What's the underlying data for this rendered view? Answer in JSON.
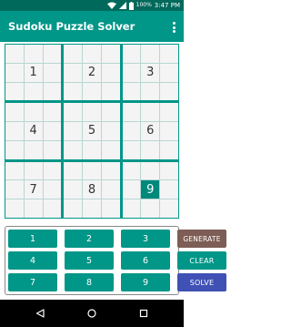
{
  "status_bar": {
    "battery": "100%",
    "time": "3:47 PM"
  },
  "app_bar": {
    "title": "Sudoku Puzzle Solver"
  },
  "board": {
    "boxes": [
      [
        "",
        "",
        "",
        "",
        "1",
        "",
        "",
        "",
        ""
      ],
      [
        "",
        "",
        "",
        "",
        "2",
        "",
        "",
        "",
        ""
      ],
      [
        "",
        "",
        "",
        "",
        "3",
        "",
        "",
        "",
        ""
      ],
      [
        "",
        "",
        "",
        "",
        "4",
        "",
        "",
        "",
        ""
      ],
      [
        "",
        "",
        "",
        "",
        "5",
        "",
        "",
        "",
        ""
      ],
      [
        "",
        "",
        "",
        "",
        "6",
        "",
        "",
        "",
        ""
      ],
      [
        "",
        "",
        "",
        "",
        "7",
        "",
        "",
        "",
        ""
      ],
      [
        "",
        "",
        "",
        "",
        "8",
        "",
        "",
        "",
        ""
      ],
      [
        "",
        "",
        "",
        "",
        "9",
        "",
        "",
        "",
        ""
      ]
    ]
  },
  "keypad": {
    "key_1": "1",
    "key_2": "2",
    "key_3": "3",
    "generate": "GENERATE",
    "key_4": "4",
    "key_5": "5",
    "key_6": "6",
    "clear": "CLEAR",
    "key_7": "7",
    "key_8": "8",
    "key_9": "9",
    "solve": "SOLVE"
  },
  "colors": {
    "primary": "#009688",
    "primary_dark": "#00695c",
    "generate": "#7d5d55",
    "solve": "#3f51b5"
  },
  "icons": [
    "wifi-icon",
    "signal-icon",
    "battery-icon",
    "overflow-menu-icon",
    "back-icon",
    "home-icon",
    "recents-icon"
  ]
}
